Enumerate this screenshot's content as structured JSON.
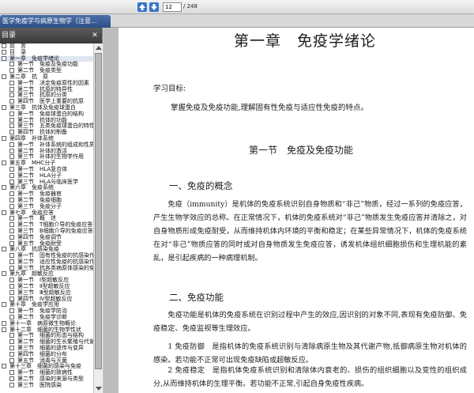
{
  "toolbar": {
    "page_current": "12",
    "page_total": "/ 248"
  },
  "tab": {
    "title": "医学免疫学与病原生物学（注意..."
  },
  "sidebar": {
    "header": "目录",
    "items": [
      {
        "label": "前　言",
        "level": 0
      },
      {
        "label": "目　录",
        "level": 0
      },
      {
        "label": "第一章　免疫学绪论",
        "level": 0,
        "selected": true
      },
      {
        "label": "第一节　免疫及免疫功能",
        "level": 1
      },
      {
        "label": "第二节　免疫类型",
        "level": 1
      },
      {
        "label": "第二章　抗　原",
        "level": 0
      },
      {
        "label": "第一节　决定免疫原性的因素",
        "level": 1
      },
      {
        "label": "第二节　抗原的特异性",
        "level": 1
      },
      {
        "label": "第三节　抗原的分类",
        "level": 1
      },
      {
        "label": "第四节　医学上重要的抗原",
        "level": 1
      },
      {
        "label": "第三章　抗体及免疫球蛋白",
        "level": 0
      },
      {
        "label": "第一节　免疫球蛋白的结构",
        "level": 1
      },
      {
        "label": "第二节　抗体的功能",
        "level": 1
      },
      {
        "label": "第三节　五类免疫球蛋白的特性",
        "level": 1
      },
      {
        "label": "第四节　抗体的制备",
        "level": 1
      },
      {
        "label": "第四章　补体系统",
        "level": 0
      },
      {
        "label": "第一节　补体系统的组成和性质",
        "level": 1
      },
      {
        "label": "第二节　补体的激活",
        "level": 1
      },
      {
        "label": "第三节　补体的生物学作用",
        "level": 1
      },
      {
        "label": "第五章　MHC分子",
        "level": 0
      },
      {
        "label": "第一节　HLA复合体",
        "level": 1
      },
      {
        "label": "第二节　HLA分子",
        "level": 1
      },
      {
        "label": "第三节　HLA与临床医学",
        "level": 1
      },
      {
        "label": "第六章　免疫系统",
        "level": 0
      },
      {
        "label": "第一节　免疫器官",
        "level": 1
      },
      {
        "label": "第二节　免疫细胞",
        "level": 1
      },
      {
        "label": "第三节　免疫分子",
        "level": 1
      },
      {
        "label": "第七章　免疫应答",
        "level": 0
      },
      {
        "label": "第一节　概　述",
        "level": 1
      },
      {
        "label": "第二节　T细胞介导的免疫应答",
        "level": 1
      },
      {
        "label": "第三节　B细胞介导的免疫应答",
        "level": 1
      },
      {
        "label": "第四节　免疫调节",
        "level": 1
      },
      {
        "label": "第五节　免疫耐受",
        "level": 1
      },
      {
        "label": "第八章　抗感染免疫",
        "level": 0
      },
      {
        "label": "第一节　固有性免疫的抗感染作用",
        "level": 1
      },
      {
        "label": "第二节　适应性免疫的抗感染作用",
        "level": 1
      },
      {
        "label": "第三节　抗各类病原体感染的免疫",
        "level": 1
      },
      {
        "label": "第九章　超敏反应",
        "level": 0
      },
      {
        "label": "第一节　Ⅰ型超敏反应",
        "level": 1
      },
      {
        "label": "第二节　Ⅱ型超敏反应",
        "level": 1
      },
      {
        "label": "第三节　Ⅲ型超敏反应",
        "level": 1
      },
      {
        "label": "第四节　Ⅳ型超敏反应",
        "level": 1
      },
      {
        "label": "第十章　免疫学应用",
        "level": 0
      },
      {
        "label": "第一节　免疫学防治",
        "level": 1
      },
      {
        "label": "第二节　免疫学诊断",
        "level": 1
      },
      {
        "label": "第十一章　病原微生物概论",
        "level": 0
      },
      {
        "label": "第十二章　细菌的生物学性状",
        "level": 0
      },
      {
        "label": "第一节　细菌的形态与结构",
        "level": 1
      },
      {
        "label": "第二节　细菌的生长繁殖与代谢",
        "level": 1
      },
      {
        "label": "第三节　细菌的遗传与变异",
        "level": 1
      },
      {
        "label": "第四节　细菌的分布",
        "level": 1
      },
      {
        "label": "第五节　消毒与灭菌",
        "level": 1
      },
      {
        "label": "第十三章　细菌的感染与免疫",
        "level": 0
      },
      {
        "label": "第一节　细菌的致病性",
        "level": 1
      },
      {
        "label": "第二节　感染的来源与类型",
        "level": 1
      },
      {
        "label": "第三节　医院感染",
        "level": 1
      }
    ]
  },
  "document": {
    "chapter_title": "第一章　免疫学绪论",
    "goal_label": "学习目标:",
    "goal_text": "掌握免疫及免疫功能,理解固有性免疫与适应性免疫的特点。",
    "section_title": "第一节　免疫及免疫功能",
    "heading_concept": "一、免疫的概念",
    "para_concept": "免疫（immunity）是机体的免疫系统识别自身物质和“非己”物质，经过一系列的免疫应答，产生生物学效应的总称。在正常情况下，机体的免疫系统对“非己”物质发生免疫应答并清除之，对自身物质形成免疫耐受，从而维持机体内环境的平衡和稳定；在某些异常情况下，机体的免疫系统在对“非己”物质应答的同时或对自身物质发生免疫应答，诱发机体组织细胞损伤和生理机能的紊乱，是引起疾病的一种病理机制。",
    "heading_function": "二、免疫功能",
    "para_function": "免疫功能是机体的免疫系统在识别过程中产生的效应,因识别的对象不同,表现有免疫防御、免疫稳定、免疫监视等生理效应。",
    "para_defense": "1 免疫防御　是指机体的免疫系统识别与清除病原生物及其代谢产物,抵御病原生物对机体的感染。若功能不正常可出现免疫缺陷或超敏反应。",
    "para_stability": "2 免疫稳定　是指机体免疫系统识别和清除体内衰老的、损伤的组织细胞以及变性的组织成分,从而维持机体的生理平衡。若功能不正常,引起自身免疫性疾病。"
  }
}
